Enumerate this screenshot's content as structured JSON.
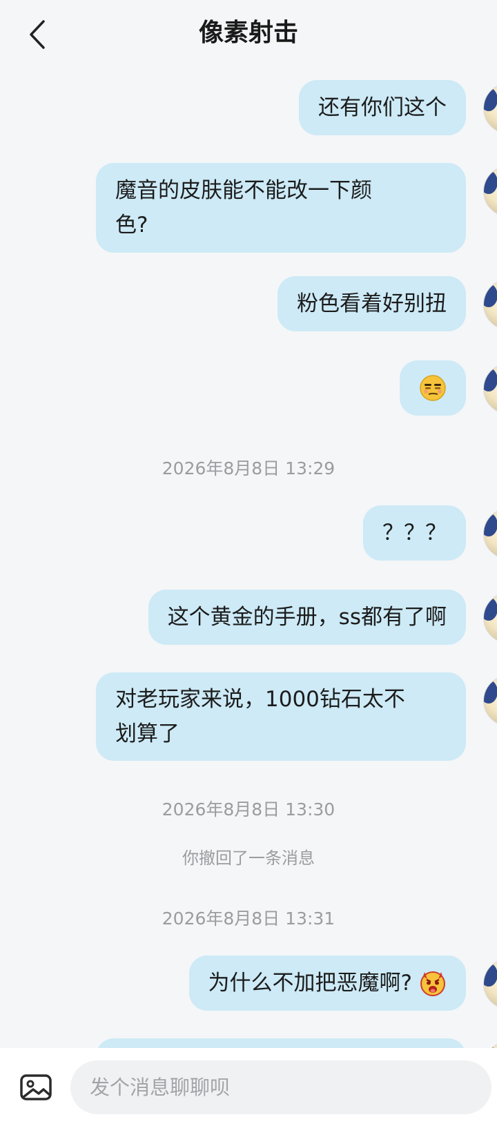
{
  "header": {
    "title": "像素射击"
  },
  "messages": [
    {
      "text": "还有你们这个"
    },
    {
      "text_line1": "魔音的皮肤能不能改一下颜",
      "text_line2": "色?"
    },
    {
      "text": "粉色看着好别扭"
    },
    {
      "emoji": "smirk-face-emoji"
    },
    {
      "text": "？？？"
    },
    {
      "text": "这个黄金的手册，ss都有了啊"
    },
    {
      "text_line1": "对老玩家来说，1000钻石太不",
      "text_line2": "划算了"
    },
    {
      "text": "为什么不加把恶魔啊?",
      "emoji": "devil-face-emoji"
    }
  ],
  "timestamps": {
    "t1": "2026年8月8日 13:29",
    "t2": "2026年8月8日 13:30",
    "t3": "2026年8月8日 13:31"
  },
  "system": {
    "recalled": "你撤回了一条消息"
  },
  "composer": {
    "placeholder": "发个消息聊聊呗"
  },
  "colors": {
    "bubble": "#cdeaf6",
    "background": "#f5f6f8",
    "muted": "#9a9ca0"
  }
}
